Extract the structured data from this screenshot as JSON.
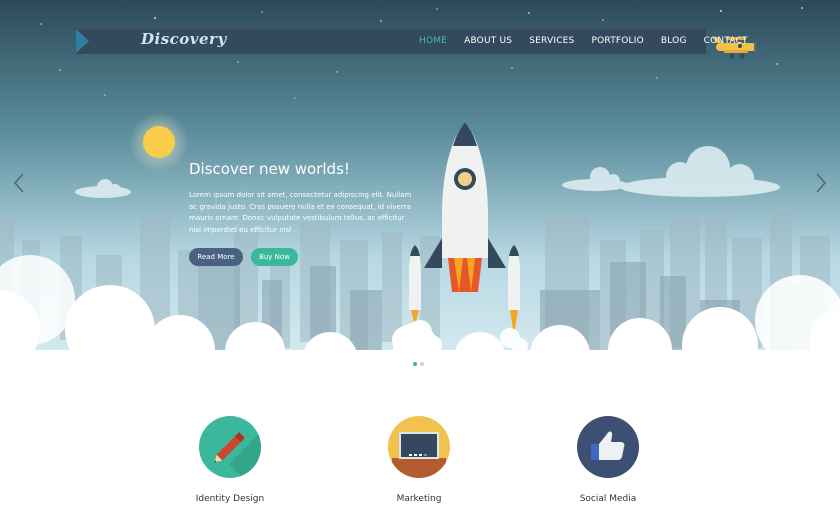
{
  "brand": {
    "logo": "Discovery"
  },
  "nav": {
    "items": [
      {
        "label": "HOME",
        "active": true
      },
      {
        "label": "ABOUT US",
        "active": false
      },
      {
        "label": "SERVICES",
        "active": false
      },
      {
        "label": "PORTFOLIO",
        "active": false
      },
      {
        "label": "BLOG",
        "active": false
      },
      {
        "label": "CONTACT",
        "active": false
      }
    ]
  },
  "hero": {
    "headline": "Discover new worlds!",
    "body": "Lorem ipsum dolor sit amet, consectetur adipiscing elit. Nullam ac gravida justo. Cras posuere nulla et ex consequat, id viverra mauris ornare. Donec vulputate vestibulum tellus, ac efficitur nisl imperdiet eu efficitur nisl .",
    "read_more_label": "Read More",
    "buy_now_label": "Buy Now",
    "slides": 2,
    "active_slide": 1
  },
  "features": [
    {
      "title": "Identity Design",
      "icon": "pencil-icon",
      "color": "#3bb89c"
    },
    {
      "title": "Marketing",
      "icon": "blackboard-icon",
      "color": "#f1c24e"
    },
    {
      "title": "Social Media",
      "icon": "thumbs-up-icon",
      "color": "#3d4f73"
    }
  ],
  "colors": {
    "accent": "#3bb89c",
    "nav_bg": "#34495e",
    "button_primary": "#4a6282"
  }
}
